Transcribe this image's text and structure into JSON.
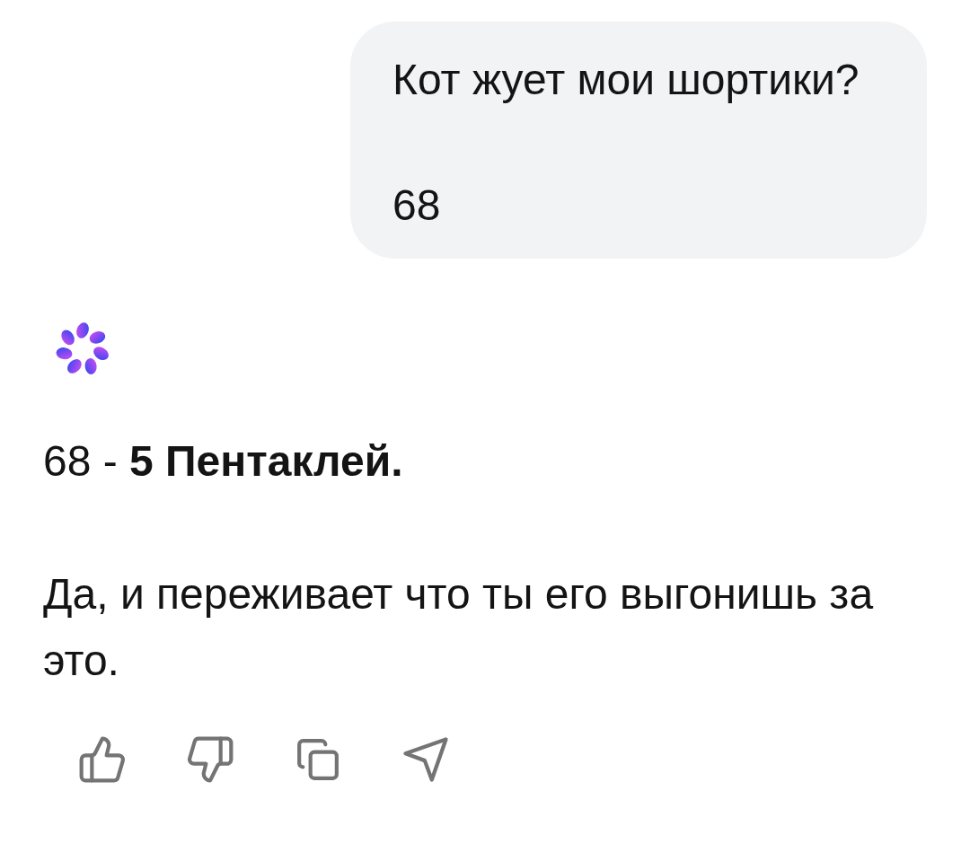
{
  "user_message": {
    "paragraphs": [
      "Кот жует мои шортики?",
      "68"
    ]
  },
  "assistant_message": {
    "paragraphs": [
      "68 - **5 Пентаклей.**",
      "Да, и переживает что ты его выгонишь за это."
    ]
  },
  "actions": [
    {
      "kind": "like"
    },
    {
      "kind": "dislike"
    },
    {
      "kind": "copy"
    },
    {
      "kind": "share"
    }
  ]
}
